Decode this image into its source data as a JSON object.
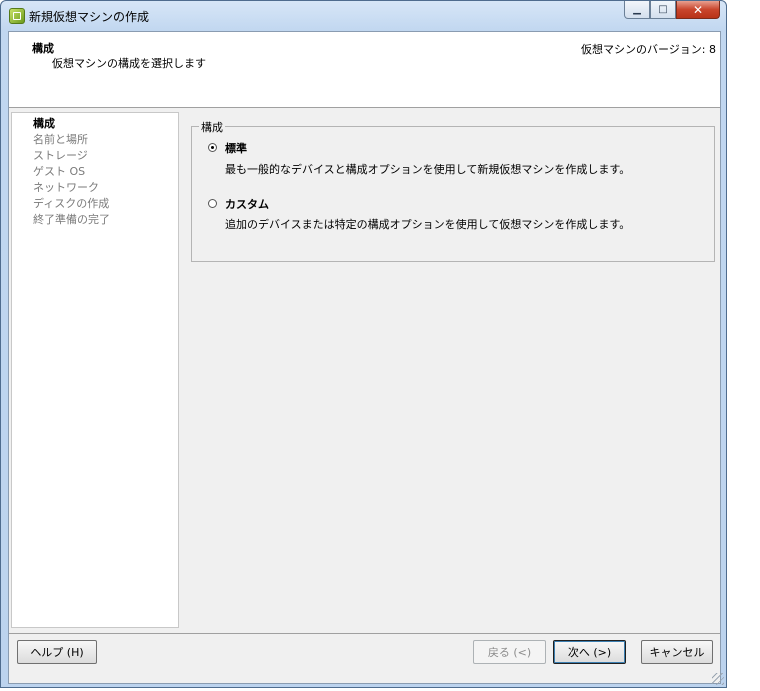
{
  "window": {
    "title": "新規仮想マシンの作成"
  },
  "header": {
    "title": "構成",
    "subtitle": "仮想マシンの構成を選択します",
    "version": "仮想マシンのバージョン: 8"
  },
  "nav": {
    "items": [
      {
        "label": "構成",
        "active": true
      },
      {
        "label": "名前と場所",
        "active": false
      },
      {
        "label": "ストレージ",
        "active": false
      },
      {
        "label": "ゲスト OS",
        "active": false
      },
      {
        "label": "ネットワーク",
        "active": false
      },
      {
        "label": "ディスクの作成",
        "active": false
      },
      {
        "label": "終了準備の完了",
        "active": false
      }
    ]
  },
  "config": {
    "group_label": "構成",
    "options": [
      {
        "label": "標準",
        "description": "最も一般的なデバイスと構成オプションを使用して新規仮想マシンを作成します。",
        "selected": true
      },
      {
        "label": "カスタム",
        "description": "追加のデバイスまたは特定の構成オプションを使用して仮想マシンを作成します。",
        "selected": false
      }
    ]
  },
  "buttons": {
    "help": "ヘルプ (H)",
    "back": "戻る (<)",
    "next": "次へ (>)",
    "cancel": "キャンセル"
  },
  "icons": {
    "app": "vsphere-app-icon",
    "minimize": "minimize-icon",
    "maximize": "maximize-icon",
    "close": "close-icon"
  }
}
